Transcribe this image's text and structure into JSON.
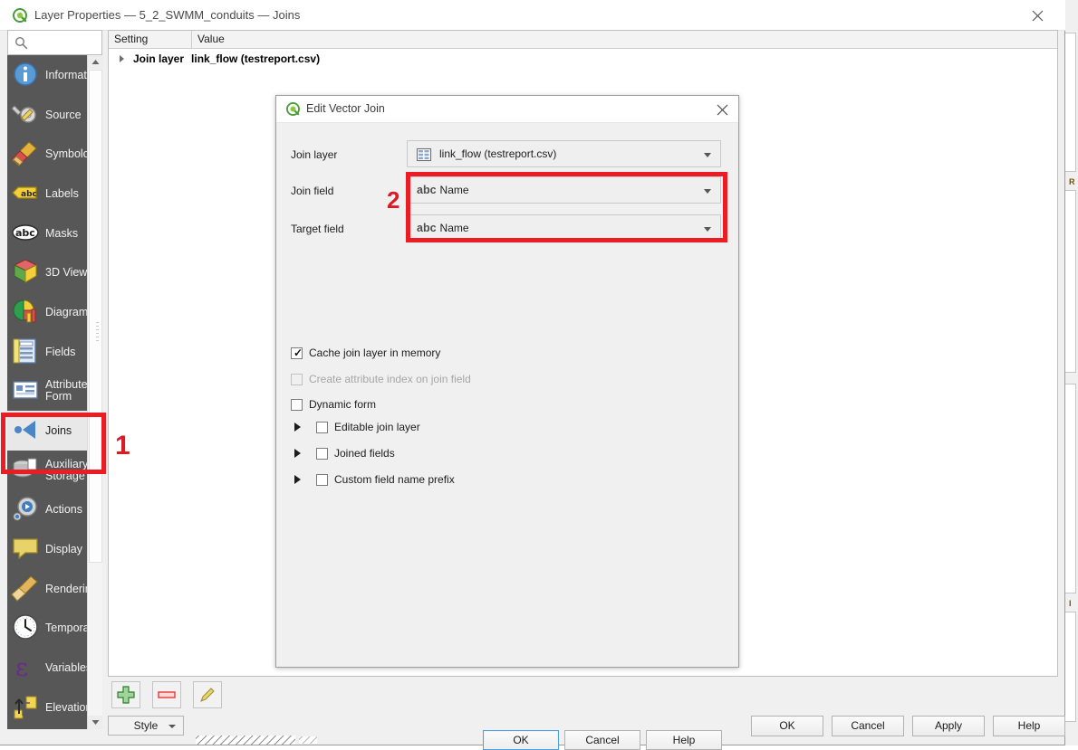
{
  "window": {
    "title": "Layer Properties — 5_2_SWMM_conduits — Joins",
    "icon": "qgis-icon",
    "close_label": "close-icon"
  },
  "search": {
    "placeholder": "",
    "value": "",
    "icon": "search-icon"
  },
  "sidebar": {
    "items": [
      {
        "label": "Information",
        "icon": "information-icon",
        "selected": false
      },
      {
        "label": "Source",
        "icon": "source-icon",
        "selected": false
      },
      {
        "label": "Symbology",
        "icon": "symbology-icon",
        "selected": false
      },
      {
        "label": "Labels",
        "icon": "labels-icon",
        "selected": false
      },
      {
        "label": "Masks",
        "icon": "masks-icon",
        "selected": false
      },
      {
        "label": "3D View",
        "icon": "3d-view-icon",
        "selected": false
      },
      {
        "label": "Diagrams",
        "icon": "diagrams-icon",
        "selected": false
      },
      {
        "label": "Fields",
        "icon": "fields-icon",
        "selected": false
      },
      {
        "label": "Attributes Form",
        "icon": "attributes-form-icon",
        "selected": false
      },
      {
        "label": "Joins",
        "icon": "joins-icon",
        "selected": true
      },
      {
        "label": "Auxiliary Storage",
        "icon": "auxiliary-storage-icon",
        "selected": false
      },
      {
        "label": "Actions",
        "icon": "actions-icon",
        "selected": false
      },
      {
        "label": "Display",
        "icon": "display-icon",
        "selected": false
      },
      {
        "label": "Rendering",
        "icon": "rendering-icon",
        "selected": false
      },
      {
        "label": "Temporal",
        "icon": "temporal-icon",
        "selected": false
      },
      {
        "label": "Variables",
        "icon": "variables-icon",
        "selected": false
      },
      {
        "label": "Elevation",
        "icon": "elevation-icon",
        "selected": false
      }
    ]
  },
  "joins_table": {
    "columns": [
      "Setting",
      "Value"
    ],
    "rows": [
      {
        "setting": "Join layer",
        "value": "link_flow (testreport.csv)"
      }
    ]
  },
  "toolbar": {
    "add_label": "add-join-icon",
    "remove_label": "remove-join-icon",
    "edit_label": "edit-join-icon",
    "style_label": "Style"
  },
  "footer": {
    "ok": "OK",
    "cancel": "Cancel",
    "apply": "Apply",
    "help": "Help"
  },
  "dialog": {
    "title": "Edit Vector Join",
    "icon": "qgis-icon",
    "close_label": "close-icon",
    "fields": {
      "join_layer_label": "Join layer",
      "join_layer_value": "link_flow (testreport.csv)",
      "join_field_label": "Join field",
      "join_field_type": "abc",
      "join_field_value": "Name",
      "target_field_label": "Target field",
      "target_field_type": "abc",
      "target_field_value": "Name"
    },
    "checkboxes": [
      {
        "label": "Cache join layer in memory",
        "checked": true,
        "enabled": true,
        "expandable": false
      },
      {
        "label": "Create attribute index on join field",
        "checked": false,
        "enabled": false,
        "expandable": false
      },
      {
        "label": "Dynamic form",
        "checked": false,
        "enabled": true,
        "expandable": false
      },
      {
        "label": "Editable join layer",
        "checked": false,
        "enabled": true,
        "expandable": true
      },
      {
        "label": "Joined fields",
        "checked": false,
        "enabled": true,
        "expandable": true
      },
      {
        "label": "Custom field name prefix",
        "checked": false,
        "enabled": true,
        "expandable": true
      }
    ],
    "buttons": {
      "ok": "OK",
      "cancel": "Cancel",
      "help": "Help"
    }
  },
  "annotations": [
    {
      "number": "1",
      "color": "#d91d26",
      "target": "joins-sidebar-item"
    },
    {
      "number": "2",
      "color": "#d91d26",
      "target": "join-and-target-field-combos"
    }
  ],
  "colors": {
    "annotation_red": "#ec1c24",
    "sidebar_bg": "#575757",
    "selection_bg": "#e8e8e8"
  }
}
